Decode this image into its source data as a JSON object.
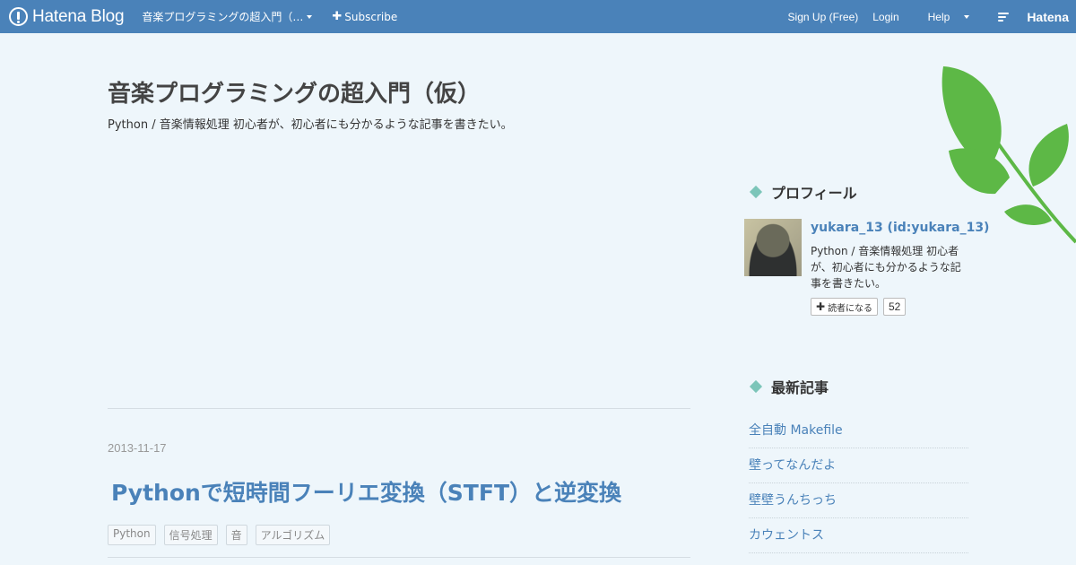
{
  "topbar": {
    "logo_text": "Hatena Blog",
    "blog_menu_label": "音楽プログラミングの超入門（…",
    "subscribe_label": "Subscribe",
    "signup_label": "Sign Up (Free)",
    "login_label": "Login",
    "help_label": "Help",
    "hatena_label": "Hatena"
  },
  "header": {
    "title": "音楽プログラミングの超入門（仮）",
    "description": "Python / 音楽情報処理 初心者が、初心者にも分かるような記事を書きたい。"
  },
  "entry": {
    "date": "2013-11-17",
    "title": "Pythonで短時間フーリエ変換（STFT）と逆変換",
    "tags": [
      "Python",
      "信号処理",
      "音",
      "アルゴリズム"
    ]
  },
  "sidebar": {
    "profile_title": "プロフィール",
    "profile_name": "yukara_13 (id:yukara_13)",
    "profile_desc": "Python / 音楽情報処理 初心者が、初心者にも分かるような記事を書きたい。",
    "subscribe_btn_label": "読者になる",
    "subscriber_count": "52",
    "recent_title": "最新記事",
    "recent_entries": [
      "全自動 Makefile",
      "壁ってなんだよ",
      "壁壁うんちっち",
      "カウェントス"
    ]
  },
  "colors": {
    "topbar": "#4a82b9",
    "background": "#eef6fb",
    "link": "#4a82b9",
    "accent_diamond": "#7cc5b9",
    "leaf": "#5db846"
  }
}
